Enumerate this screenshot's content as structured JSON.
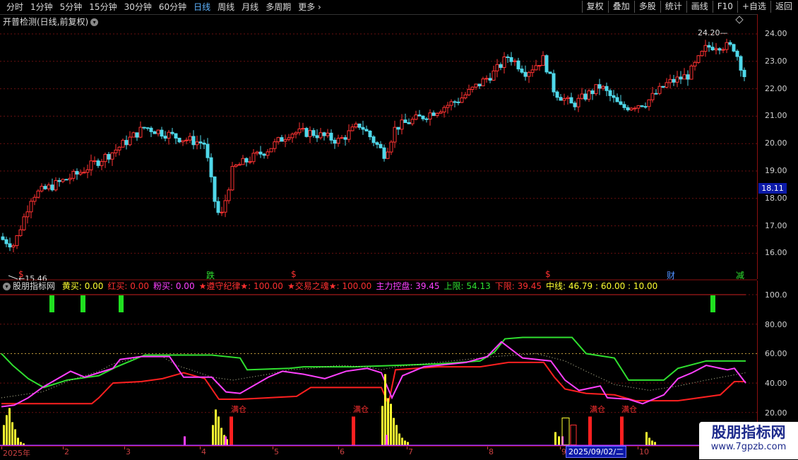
{
  "toolbar": {
    "periods": [
      "分时",
      "1分钟",
      "5分钟",
      "15分钟",
      "30分钟",
      "60分钟",
      "日线",
      "周线",
      "月线",
      "多周期",
      "更多"
    ],
    "active": "日线",
    "right": [
      "复权",
      "叠加",
      "多股",
      "统计",
      "画线",
      "F10",
      "+自选",
      "返回"
    ]
  },
  "main": {
    "title": "开普检测(日线,前复权)",
    "price_axis": [
      "24.00",
      "23.00",
      "22.00",
      "21.00",
      "20.00",
      "19.00",
      "18.00",
      "17.00",
      "16.00"
    ],
    "current_price": "18.11",
    "high_label": "24.20",
    "low_label": "15.46",
    "flags": [
      {
        "text": "$",
        "color": "#ff3030"
      },
      {
        "text": "跌",
        "color": "#30e030"
      },
      {
        "text": "$",
        "color": "#ff3030"
      },
      {
        "text": "$",
        "color": "#ff3030"
      },
      {
        "text": "财",
        "color": "#5090ff"
      },
      {
        "text": "减",
        "color": "#30e030"
      }
    ]
  },
  "indicator": {
    "name": "股朋指标网",
    "items": [
      {
        "label": "黄买:",
        "value": "0.00",
        "color": "#ffff30"
      },
      {
        "label": "红买:",
        "value": "0.00",
        "color": "#ff3030"
      },
      {
        "label": "粉买:",
        "value": "0.00",
        "color": "#ff40ff"
      },
      {
        "label": "★遵守纪律★:",
        "value": "100.00",
        "color": "#ff3030"
      },
      {
        "label": "★交易之魂★:",
        "value": "100.00",
        "color": "#ff3030"
      },
      {
        "label": "主力控盘:",
        "value": "39.45",
        "color": "#ff40ff"
      },
      {
        "label": "上限:",
        "value": "54.13",
        "color": "#30e030"
      },
      {
        "label": "下限:",
        "value": "39.45",
        "color": "#ff3030"
      },
      {
        "label": "中线:",
        "value": "46.79 : 60.00 : 10.00",
        "color": "#ffff30"
      }
    ],
    "axis": [
      "100.0",
      "80.00",
      "60.00",
      "40.00",
      "20.00"
    ],
    "man_cang": [
      "满仓",
      "满仓",
      "满仓",
      "满仓"
    ]
  },
  "date_axis": {
    "labels": [
      "2025年",
      "2",
      "3",
      "4",
      "5",
      "6",
      "7",
      "8",
      "9",
      "10"
    ],
    "cursor": "2025/09/02/二"
  },
  "watermark": {
    "title": "股朋指标网",
    "url": "www.7gpzb.com"
  }
}
